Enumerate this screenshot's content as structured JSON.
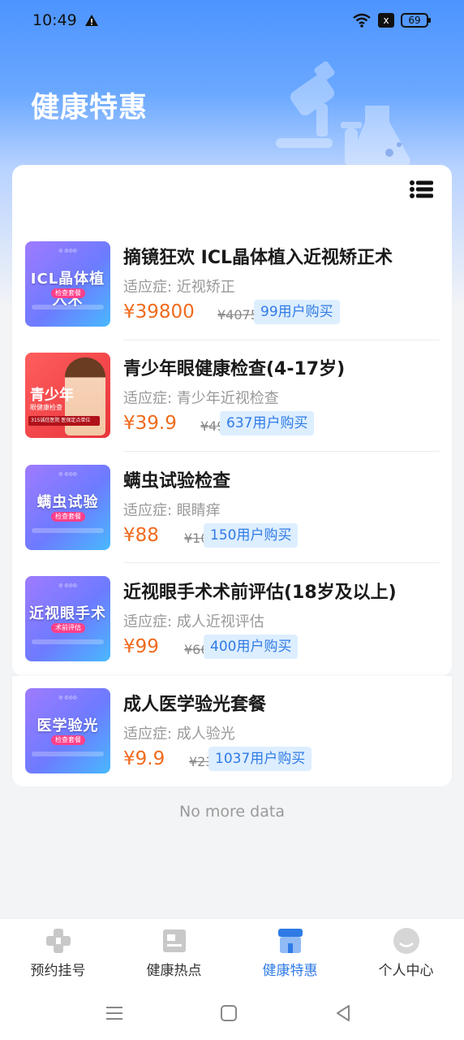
{
  "status_bar": {
    "time": "10:49",
    "battery": "69",
    "sim": "x"
  },
  "header": {
    "title": "健康特惠"
  },
  "products": [
    {
      "thumb_text": "ICL晶体植入术",
      "thumb_tag": "检查套餐",
      "name": "摘镜狂欢  ICL晶体植入近视矫正术",
      "indication": "适应症:  近视矫正",
      "price": "¥39800",
      "original_price": "¥40750",
      "buyers": "99用户购买"
    },
    {
      "thumb_text": "青少年",
      "thumb_tag": "眼健康检查",
      "thumb_bar": "315诚信医院 医保定点单位",
      "name": "青少年眼健康检查(4-17岁)",
      "indication": "适应症:  青少年近视检查",
      "price": "¥39.9",
      "original_price": "¥493",
      "buyers": "637用户购买"
    },
    {
      "thumb_text": "螨虫试验",
      "thumb_tag": "检查套餐",
      "name": "螨虫试验检查",
      "indication": "适应症:  眼睛痒",
      "price": "¥88",
      "original_price": "¥100",
      "buyers": "150用户购买"
    },
    {
      "thumb_text": "近视眼手术",
      "thumb_tag": "术前评估",
      "name": "近视眼手术术前评估(18岁及以上)",
      "indication": "适应症:  成人近视评估",
      "price": "¥99",
      "original_price": "¥668",
      "buyers": "400用户购买"
    },
    {
      "thumb_text": "医学验光",
      "thumb_tag": "检查套餐",
      "name": "成人医学验光套餐",
      "indication": "适应症:  成人验光",
      "price": "¥9.9",
      "original_price": "¥235",
      "buyers": "1037用户购买"
    }
  ],
  "footer_text": "No more data",
  "tabs": [
    {
      "label": "预约挂号",
      "icon": "appointment-icon"
    },
    {
      "label": "健康热点",
      "icon": "news-icon"
    },
    {
      "label": "健康特惠",
      "icon": "shop-icon"
    },
    {
      "label": "个人中心",
      "icon": "profile-icon"
    }
  ],
  "colors": {
    "accent": "#2f7be6",
    "price": "#f06b1e",
    "header_blue": "#4d94ff"
  }
}
